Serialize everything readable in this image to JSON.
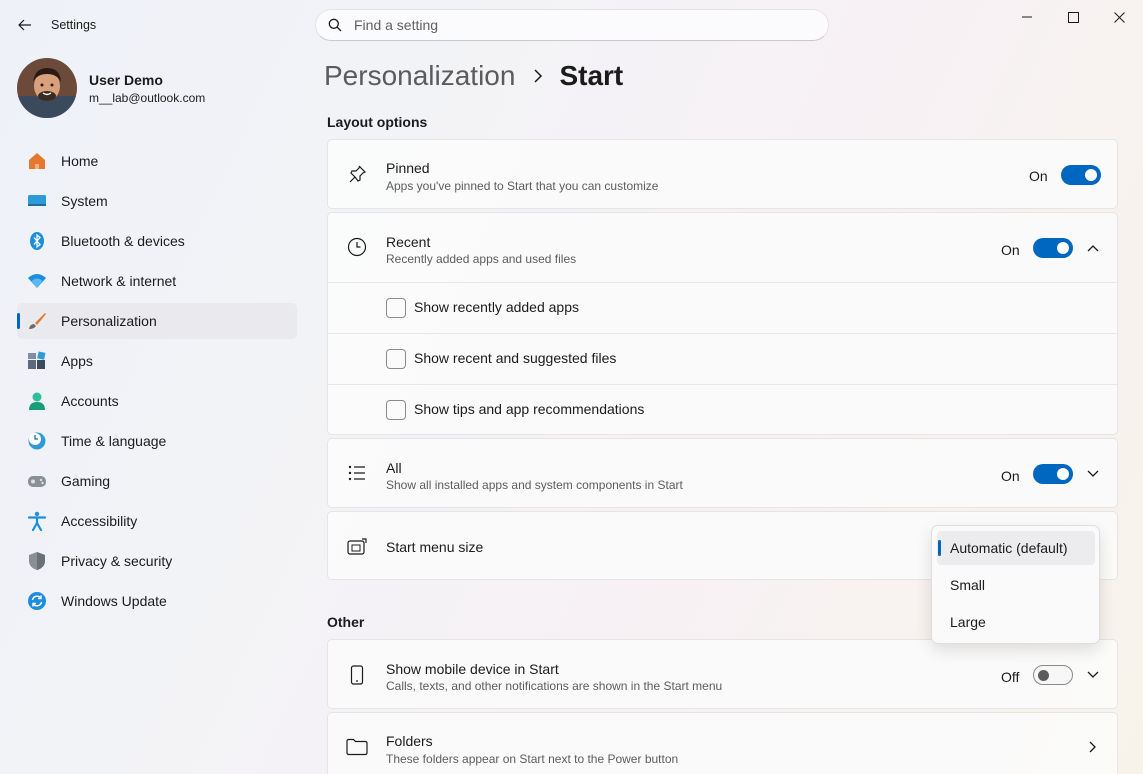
{
  "window": {
    "app_title": "Settings"
  },
  "search": {
    "placeholder": "Find a setting"
  },
  "profile": {
    "name": "User Demo",
    "email": "m__lab@outlook.com"
  },
  "sidebar": {
    "items": [
      {
        "label": "Home",
        "icon": "home-icon"
      },
      {
        "label": "System",
        "icon": "system-icon"
      },
      {
        "label": "Bluetooth & devices",
        "icon": "bluetooth-icon"
      },
      {
        "label": "Network & internet",
        "icon": "wifi-icon"
      },
      {
        "label": "Personalization",
        "icon": "brush-icon",
        "active": true
      },
      {
        "label": "Apps",
        "icon": "apps-icon"
      },
      {
        "label": "Accounts",
        "icon": "accounts-icon"
      },
      {
        "label": "Time & language",
        "icon": "time-language-icon"
      },
      {
        "label": "Gaming",
        "icon": "gamepad-icon"
      },
      {
        "label": "Accessibility",
        "icon": "accessibility-icon"
      },
      {
        "label": "Privacy & security",
        "icon": "shield-icon"
      },
      {
        "label": "Windows Update",
        "icon": "update-icon"
      }
    ]
  },
  "breadcrumb": {
    "parent": "Personalization",
    "current": "Start"
  },
  "layout_section": {
    "heading": "Layout options",
    "pinned": {
      "title": "Pinned",
      "description": "Apps you've pinned to Start that you can customize",
      "state": "On",
      "on": true
    },
    "recent": {
      "title": "Recent",
      "description": "Recently added apps and used files",
      "state": "On",
      "on": true,
      "options": [
        {
          "label": "Show recently added apps",
          "checked": false
        },
        {
          "label": "Show recent and suggested files",
          "checked": false
        },
        {
          "label": "Show tips and app recommendations",
          "checked": false
        }
      ]
    },
    "all": {
      "title": "All",
      "description": "Show all installed apps and system components in Start",
      "state": "On",
      "on": true
    },
    "menu_size": {
      "title": "Start menu size",
      "options": [
        "Automatic (default)",
        "Small",
        "Large"
      ],
      "selected": "Automatic (default)"
    }
  },
  "other_section": {
    "heading": "Other",
    "mobile": {
      "title": "Show mobile device in Start",
      "description": "Calls, texts, and other notifications are shown in the Start menu",
      "state": "Off",
      "on": false
    },
    "folders": {
      "title": "Folders",
      "description": "These folders appear on Start next to the Power button"
    }
  },
  "colors": {
    "accent": "#0067c0"
  }
}
